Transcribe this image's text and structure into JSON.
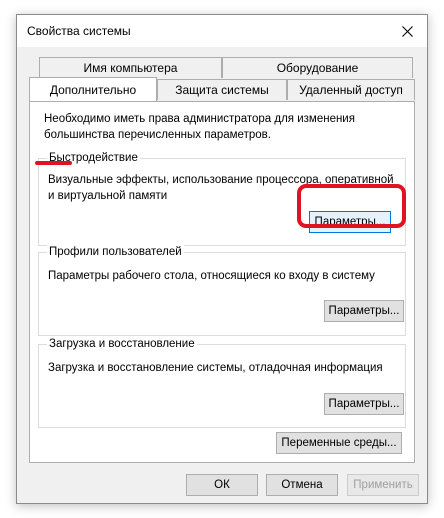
{
  "window": {
    "title": "Свойства системы"
  },
  "tabs": {
    "row1": [
      "Имя компьютера",
      "Оборудование"
    ],
    "row2": [
      "Дополнительно",
      "Защита системы",
      "Удаленный доступ"
    ],
    "active": "Дополнительно"
  },
  "panel": {
    "info": "Необходимо иметь права администратора для изменения большинства перечисленных параметров.",
    "performance": {
      "label": "Быстродействие",
      "text": "Визуальные эффекты, использование процессора, оперативной и виртуальной памяти",
      "button": "Параметры..."
    },
    "profiles": {
      "label": "Профили пользователей",
      "text": "Параметры рабочего стола, относящиеся ко входу в систему",
      "button": "Параметры..."
    },
    "startup": {
      "label": "Загрузка и восстановление",
      "text": "Загрузка и восстановление системы, отладочная информация",
      "button": "Параметры..."
    },
    "env_button": "Переменные среды..."
  },
  "footer": {
    "ok": "ОК",
    "cancel": "Отмена",
    "apply": "Применить"
  },
  "annotations": {
    "highlight_color": "#e0141e"
  },
  "icons": {
    "close": "close-icon"
  }
}
